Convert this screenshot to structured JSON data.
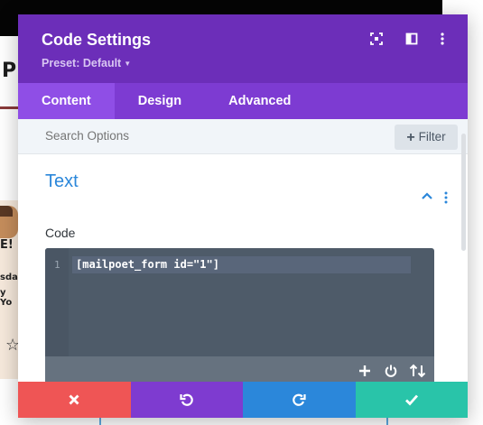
{
  "background": {
    "heading_letter": "P",
    "card_line_1": "E!",
    "card_line_2": "sda",
    "card_line_3": "y Yo",
    "card_icon": "star-outline-icon"
  },
  "modal": {
    "title": "Code Settings",
    "preset_label": "Preset: Default",
    "header_icons": [
      "focus-icon",
      "split-view-icon",
      "more-vertical-icon"
    ],
    "tabs": [
      {
        "label": "Content",
        "active": true
      },
      {
        "label": "Design",
        "active": false
      },
      {
        "label": "Advanced",
        "active": false
      }
    ],
    "search": {
      "placeholder": "Search Options"
    },
    "filter_label": "Filter",
    "section": {
      "title": "Text",
      "expanded": true
    },
    "field": {
      "label": "Code",
      "line_number": "1",
      "code": "[mailpoet_form id=\"1\"]",
      "toolbar_icons": [
        "add-icon",
        "power-icon",
        "sort-arrows-icon"
      ]
    },
    "footer_buttons": [
      {
        "action": "cancel",
        "icon": "close-icon",
        "color": "#ef5555"
      },
      {
        "action": "undo",
        "icon": "undo-icon",
        "color": "#7e3bd0"
      },
      {
        "action": "redo",
        "icon": "redo-icon",
        "color": "#2b87da"
      },
      {
        "action": "save",
        "icon": "checkmark-icon",
        "color": "#29c4a9"
      }
    ]
  },
  "colors": {
    "header": "#6c2eb9",
    "tabs_bar": "#7d3bd2",
    "active_tab": "#8f4ee6",
    "section_title": "#2b87da",
    "editor_bg": "#4e5b69"
  }
}
